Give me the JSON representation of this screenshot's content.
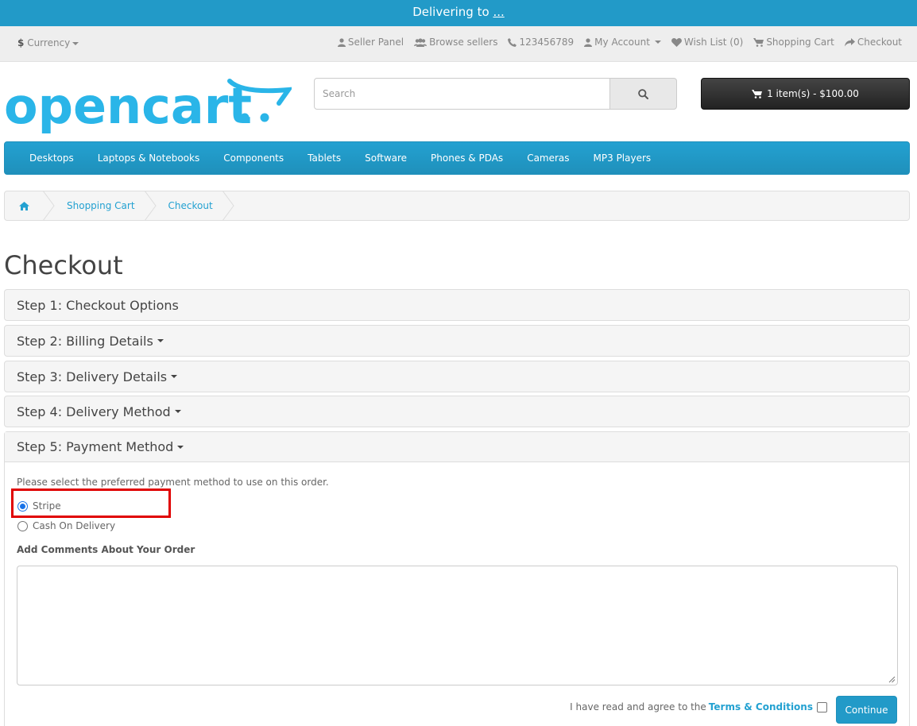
{
  "delivery": {
    "prefix": "Delivering to",
    "link": "..."
  },
  "topbar": {
    "currency_label": "Currency",
    "links": [
      {
        "label": "Seller Panel",
        "icon": "user-icon"
      },
      {
        "label": "Browse sellers",
        "icon": "users-icon"
      },
      {
        "label": "123456789",
        "icon": "phone-icon"
      },
      {
        "label": "My Account",
        "icon": "user-icon"
      },
      {
        "label": "Wish List (0)",
        "icon": "heart-icon"
      },
      {
        "label": "Shopping Cart",
        "icon": "cart-icon"
      },
      {
        "label": "Checkout",
        "icon": "share-icon"
      }
    ]
  },
  "logo": {
    "text": "opencart"
  },
  "search": {
    "placeholder": "Search"
  },
  "cart": {
    "label": "1 item(s) - $100.00"
  },
  "menu": [
    "Desktops",
    "Laptops & Notebooks",
    "Components",
    "Tablets",
    "Software",
    "Phones & PDAs",
    "Cameras",
    "MP3 Players"
  ],
  "breadcrumb": [
    "Shopping Cart",
    "Checkout"
  ],
  "page_title": "Checkout",
  "steps": [
    "Step 1: Checkout Options",
    "Step 2: Billing Details",
    "Step 3: Delivery Details",
    "Step 4: Delivery Method",
    "Step 5: Payment Method"
  ],
  "payment": {
    "intro": "Please select the preferred payment method to use on this order.",
    "options": [
      "Stripe",
      "Cash On Delivery"
    ],
    "selected": "Stripe",
    "comments_label": "Add Comments About Your Order",
    "comments_value": "",
    "agree_text": "I have read and agree to the",
    "terms_link": "Terms & Conditions",
    "continue_label": "Continue"
  },
  "colors": {
    "brand_blue": "#229ac8",
    "highlight_red": "#e00000"
  }
}
